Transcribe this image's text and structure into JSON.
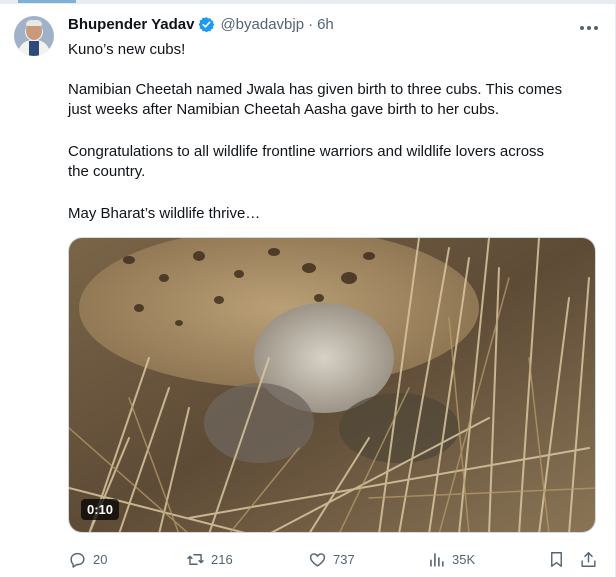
{
  "tweet": {
    "author": {
      "name": "Bhupender Yadav",
      "handle": "@byadavbjp",
      "separator": "·",
      "time": "6h"
    },
    "lines": [
      "Kuno’s new cubs!",
      "Namibian Cheetah named Jwala has given birth to three cubs. This comes",
      "just weeks after Namibian Cheetah Aasha gave birth to her cubs.",
      "Congratulations to all wildlife frontline warriors and wildlife lovers across",
      "the country.",
      "May Bharat’s wildlife thrive…"
    ],
    "media": {
      "duration": "0:10"
    },
    "actions": {
      "replies": "20",
      "reposts": "216",
      "likes": "737",
      "views": "35K"
    }
  },
  "colors": {
    "text": "#0f1419",
    "secondary": "#536471",
    "verified": "#1d9bf0",
    "border": "#cfd9de"
  },
  "icons": [
    "verified-badge-icon",
    "more-icon",
    "reply-icon",
    "repost-icon",
    "like-icon",
    "views-icon",
    "bookmark-icon",
    "share-icon"
  ]
}
